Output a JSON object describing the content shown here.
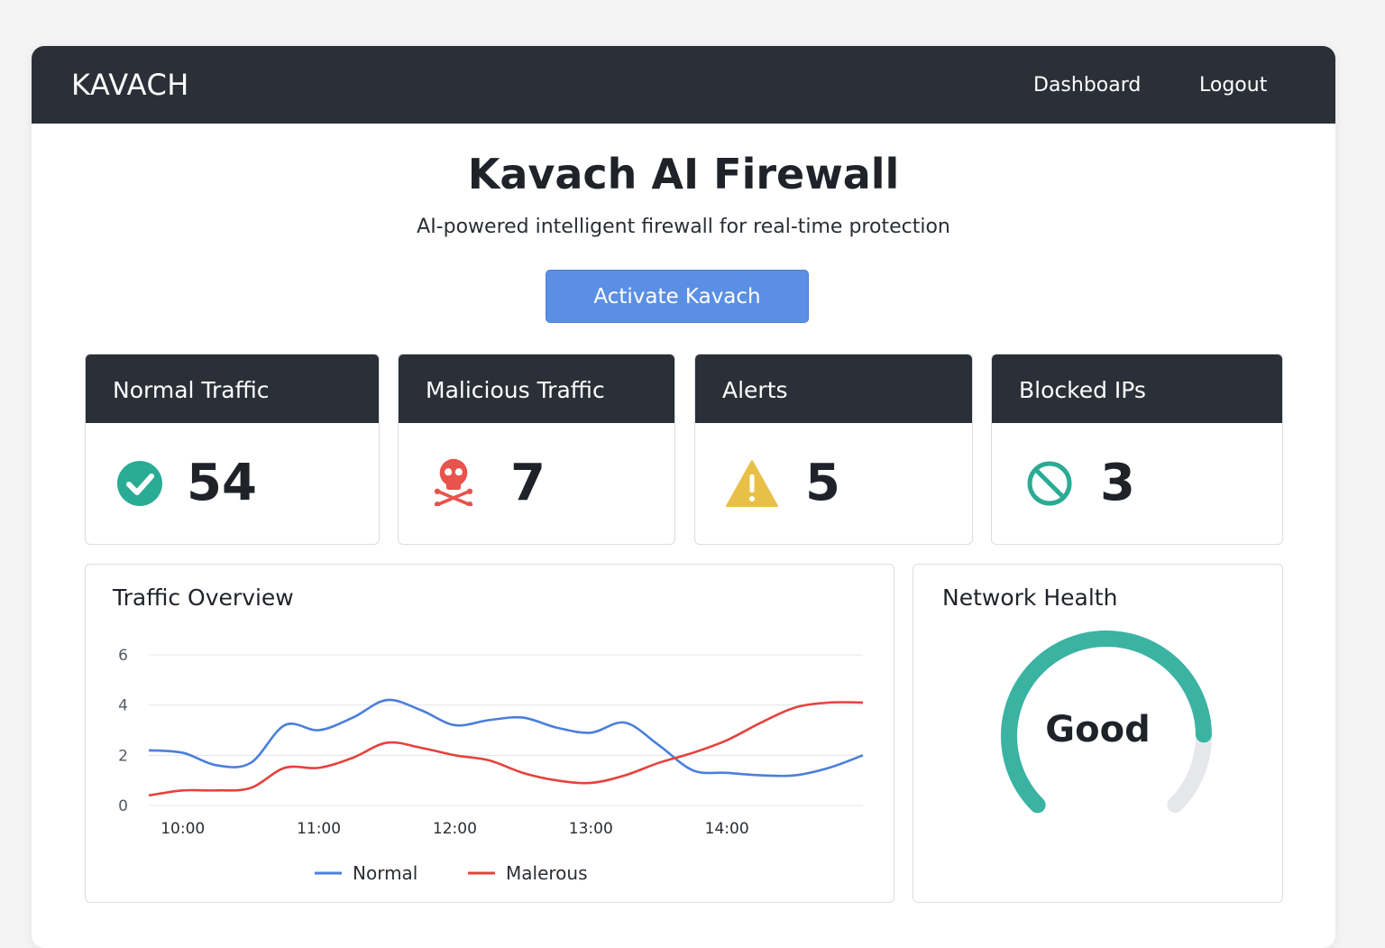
{
  "navbar": {
    "brand": "KAVACH",
    "links": {
      "dashboard": "Dashboard",
      "logout": "Logout"
    }
  },
  "hero": {
    "title": "Kavach AI Firewall",
    "subtitle": "AI-powered intelligent firewall for real-time protection",
    "activate_label": "Activate Kavach"
  },
  "stats": {
    "normal": {
      "label": "Normal Traffic",
      "value": "54",
      "icon": "check-circle-icon",
      "color": "#2aab94"
    },
    "malicious": {
      "label": "Malicious Traffic",
      "value": "7",
      "icon": "skull-crossbones-icon",
      "color": "#e8534d"
    },
    "alerts": {
      "label": "Alerts",
      "value": "5",
      "icon": "warning-triangle-icon",
      "color": "#e8c048"
    },
    "blocked": {
      "label": "Blocked IPs",
      "value": "3",
      "icon": "blocked-circle-icon",
      "color": "#2aab94"
    }
  },
  "traffic_overview": {
    "title": "Traffic Overview"
  },
  "network_health": {
    "title": "Network Health",
    "status": "Good",
    "level": 0.83,
    "color": "#3ab3a3"
  },
  "chart_data": {
    "type": "line",
    "title": "Traffic Overview",
    "x": [
      9.75,
      10,
      10.25,
      10.5,
      10.75,
      11,
      11.25,
      11.5,
      11.75,
      12,
      12.25,
      12.5,
      12.75,
      13,
      13.25,
      13.5,
      13.75,
      14,
      14.25,
      14.5,
      14.75,
      15
    ],
    "xticks": [
      "10:00",
      "11:00",
      "12:00",
      "13:00",
      "14:00"
    ],
    "xtick_values": [
      10,
      11,
      12,
      13,
      14
    ],
    "ylim": [
      0,
      6
    ],
    "yticks": [
      "0",
      "2",
      "4",
      "6"
    ],
    "ytick_values": [
      0,
      2,
      4,
      6
    ],
    "grid": true,
    "legend_position": "bottom",
    "series": [
      {
        "name": "Normal",
        "color": "#4a7fdc",
        "values": [
          2.2,
          2.1,
          1.6,
          1.7,
          3.2,
          3.0,
          3.5,
          4.2,
          3.8,
          3.2,
          3.4,
          3.5,
          3.1,
          2.9,
          3.3,
          2.4,
          1.4,
          1.3,
          1.2,
          1.2,
          1.5,
          2.0
        ]
      },
      {
        "name": "Malerous",
        "color": "#e5423d",
        "values": [
          0.4,
          0.6,
          0.6,
          0.7,
          1.5,
          1.5,
          1.9,
          2.5,
          2.3,
          2.0,
          1.8,
          1.3,
          1.0,
          0.9,
          1.2,
          1.7,
          2.1,
          2.6,
          3.3,
          3.9,
          4.1,
          4.1
        ]
      }
    ]
  }
}
